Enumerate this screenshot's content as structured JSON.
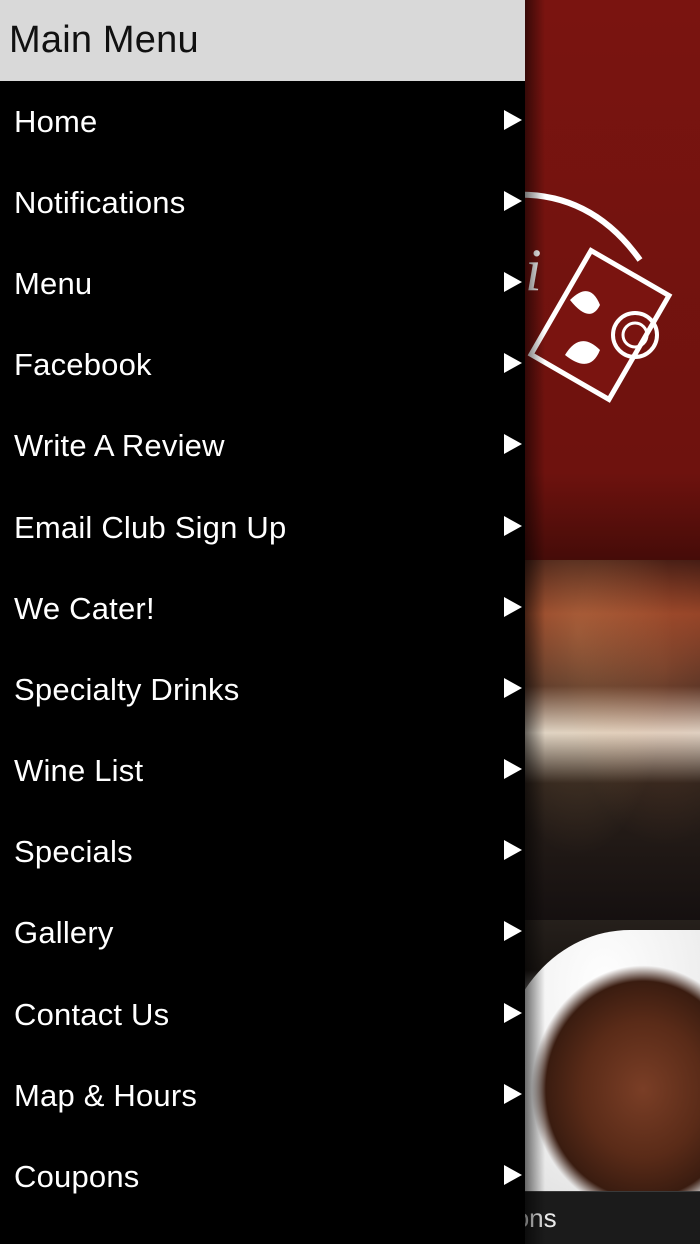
{
  "drawer": {
    "title": "Main Menu",
    "items": [
      {
        "label": "Home"
      },
      {
        "label": "Notifications"
      },
      {
        "label": "Menu"
      },
      {
        "label": "Facebook"
      },
      {
        "label": "Write A Review"
      },
      {
        "label": "Email Club Sign Up"
      },
      {
        "label": "We Cater!"
      },
      {
        "label": "Specialty Drinks"
      },
      {
        "label": "Wine List"
      },
      {
        "label": "Specials"
      },
      {
        "label": "Gallery"
      },
      {
        "label": "Contact Us"
      },
      {
        "label": "Map & Hours"
      },
      {
        "label": "Coupons"
      }
    ],
    "chevron_icon": "play-triangle-right"
  },
  "background": {
    "tab_partial_label": "Notifications",
    "colors": {
      "brand_red": "#7a1410",
      "drawer_bg": "#000000",
      "header_bg": "#d9d9d9"
    }
  }
}
